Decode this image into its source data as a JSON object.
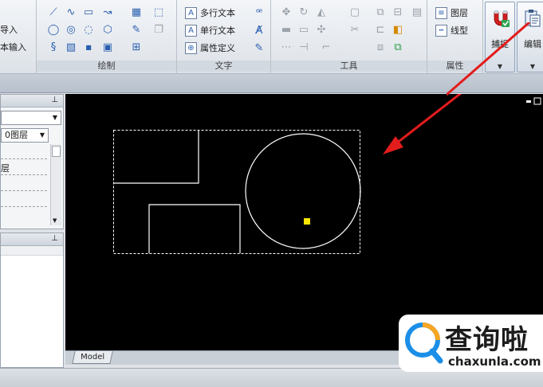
{
  "ribbon": {
    "left_labels": [
      "导入",
      "本输入"
    ],
    "draw_group": {
      "label": "绘制"
    },
    "text_group": {
      "label": "文字",
      "items": [
        "多行文本",
        "单行文本",
        "属性定义"
      ]
    },
    "tools_group": {
      "label": "工具"
    },
    "props_group": {
      "label": "属性",
      "items": [
        "图层",
        "线型"
      ]
    },
    "capture_button": {
      "label": "捕捉"
    },
    "edit_button": {
      "label": "编辑"
    }
  },
  "layer_panel": {
    "combo_value": "",
    "layer_combo_value": "0图层",
    "row_label": "层"
  },
  "canvas": {
    "background": "#000000",
    "grip_color": "#ffe600"
  },
  "tabs": {
    "model_label": "Model"
  },
  "watermark": {
    "title": "查询啦",
    "url": "chaxunla.com"
  },
  "colors": {
    "arrow": "#e31c1c",
    "ribbon_accent": "#2a5fb0"
  }
}
